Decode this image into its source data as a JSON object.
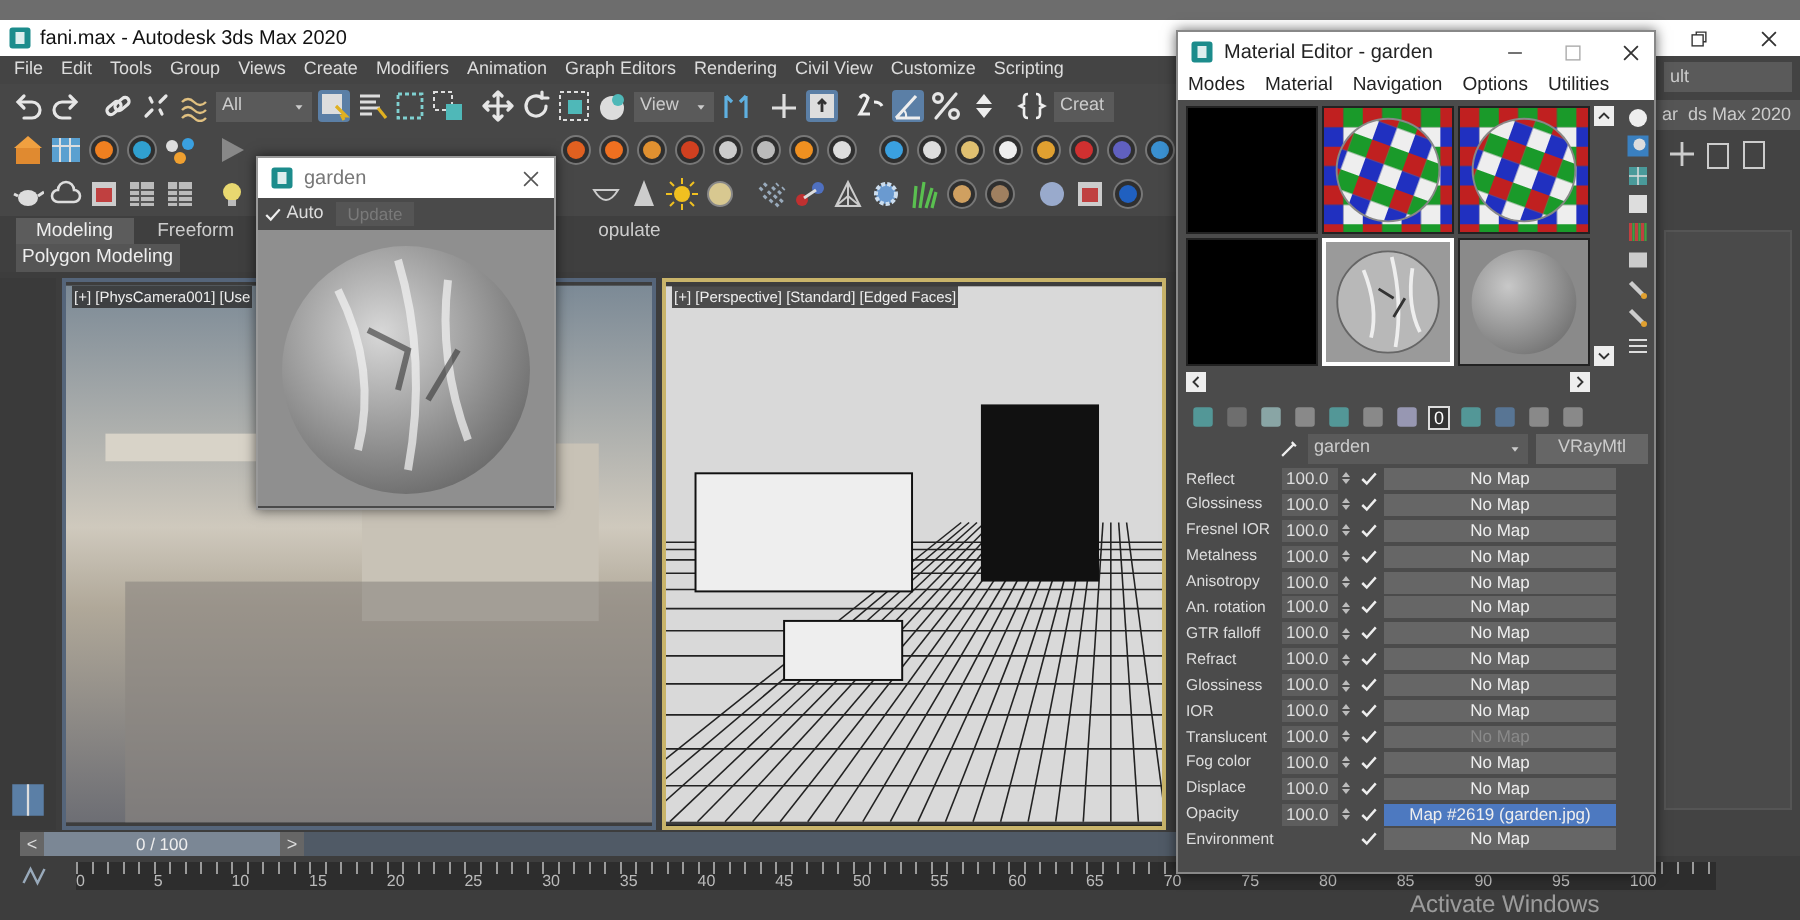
{
  "app_window": {
    "title": "fani.max - Autodesk 3ds Max 2020"
  },
  "menu_bar": [
    "File",
    "Edit",
    "Tools",
    "Group",
    "Views",
    "Create",
    "Modifiers",
    "Animation",
    "Graph Editors",
    "Rendering",
    "Civil View",
    "Customize",
    "Scripting"
  ],
  "main_toolbar": {
    "selection_filter": "All",
    "reference_coordinate": "View",
    "cut_dropdown": "Creat"
  },
  "workspace": {
    "workspaces_dropdown": "ult",
    "project_dropdown": "ar  ds Max 2020"
  },
  "ribbon": {
    "tabs": [
      {
        "label": "Modeling",
        "selected": true
      },
      {
        "label": "Freeform",
        "selected": false
      },
      {
        "label": "opulate",
        "selected": false
      }
    ],
    "panel_label": "Polygon Modeling"
  },
  "viewports": [
    {
      "kind": "photo",
      "label": "[+] [PhysCamera001] [Use",
      "active": false
    },
    {
      "kind": "wireframe",
      "label": "[+] [Perspective] [Standard] [Edged Faces]",
      "active": true
    }
  ],
  "preview_window": {
    "title": "garden",
    "auto": {
      "label": "Auto",
      "checked": true
    },
    "update_button": {
      "label": "Update",
      "disabled": true
    }
  },
  "material_editor": {
    "title": "Material Editor - garden",
    "menu": [
      "Modes",
      "Material",
      "Navigation",
      "Options",
      "Utilities"
    ],
    "sample_slots": [
      {
        "kind": "empty",
        "selected": false
      },
      {
        "kind": "checker",
        "selected": false
      },
      {
        "kind": "checker",
        "selected": false
      },
      {
        "kind": "empty",
        "selected": false
      },
      {
        "kind": "garden",
        "selected": true
      },
      {
        "kind": "plain",
        "selected": false
      }
    ],
    "toolbar_badge": "0",
    "material_name": "garden",
    "material_type": "VRayMtl",
    "parameters": [
      {
        "name": "Reflect",
        "value": "100.0",
        "checked": true,
        "map": "No Map",
        "assigned": false,
        "disabled": false
      },
      {
        "name": "Glossiness",
        "value": "100.0",
        "checked": true,
        "map": "No Map",
        "assigned": false,
        "disabled": false
      },
      {
        "name": "Fresnel IOR",
        "value": "100.0",
        "checked": true,
        "map": "No Map",
        "assigned": false,
        "disabled": false
      },
      {
        "name": "Metalness",
        "value": "100.0",
        "checked": true,
        "map": "No Map",
        "assigned": false,
        "disabled": false
      },
      {
        "name": "Anisotropy",
        "value": "100.0",
        "checked": true,
        "map": "No Map",
        "assigned": false,
        "disabled": false
      },
      {
        "name": "An. rotation",
        "value": "100.0",
        "checked": true,
        "map": "No Map",
        "assigned": false,
        "disabled": false
      },
      {
        "name": "GTR falloff",
        "value": "100.0",
        "checked": true,
        "map": "No Map",
        "assigned": false,
        "disabled": false
      },
      {
        "name": "Refract",
        "value": "100.0",
        "checked": true,
        "map": "No Map",
        "assigned": false,
        "disabled": false
      },
      {
        "name": "Glossiness",
        "value": "100.0",
        "checked": true,
        "map": "No Map",
        "assigned": false,
        "disabled": false
      },
      {
        "name": "IOR",
        "value": "100.0",
        "checked": true,
        "map": "No Map",
        "assigned": false,
        "disabled": false
      },
      {
        "name": "Translucent",
        "value": "100.0",
        "checked": true,
        "map": "No Map",
        "assigned": false,
        "disabled": true
      },
      {
        "name": "Fog color",
        "value": "100.0",
        "checked": true,
        "map": "No Map",
        "assigned": false,
        "disabled": false
      },
      {
        "name": "Displace",
        "value": "100.0",
        "checked": true,
        "map": "No Map",
        "assigned": false,
        "disabled": false
      },
      {
        "name": "Opacity",
        "value": "100.0",
        "checked": true,
        "map": "Map #2619 (garden.jpg)",
        "assigned": true,
        "disabled": false
      },
      {
        "name": "Environment",
        "checked": true,
        "map": "No Map",
        "assigned": false,
        "disabled": false
      }
    ]
  },
  "time_slider": {
    "prev": "<",
    "position": "0 / 100",
    "next": ">",
    "level": 0
  },
  "timeline": {
    "ticks": [
      "0",
      "5",
      "10",
      "15",
      "20",
      "25",
      "30",
      "35",
      "40",
      "45",
      "50",
      "55",
      "60",
      "65",
      "70",
      "75",
      "80",
      "85",
      "90",
      "95",
      "100"
    ]
  },
  "system_notice": "Activate Windows"
}
